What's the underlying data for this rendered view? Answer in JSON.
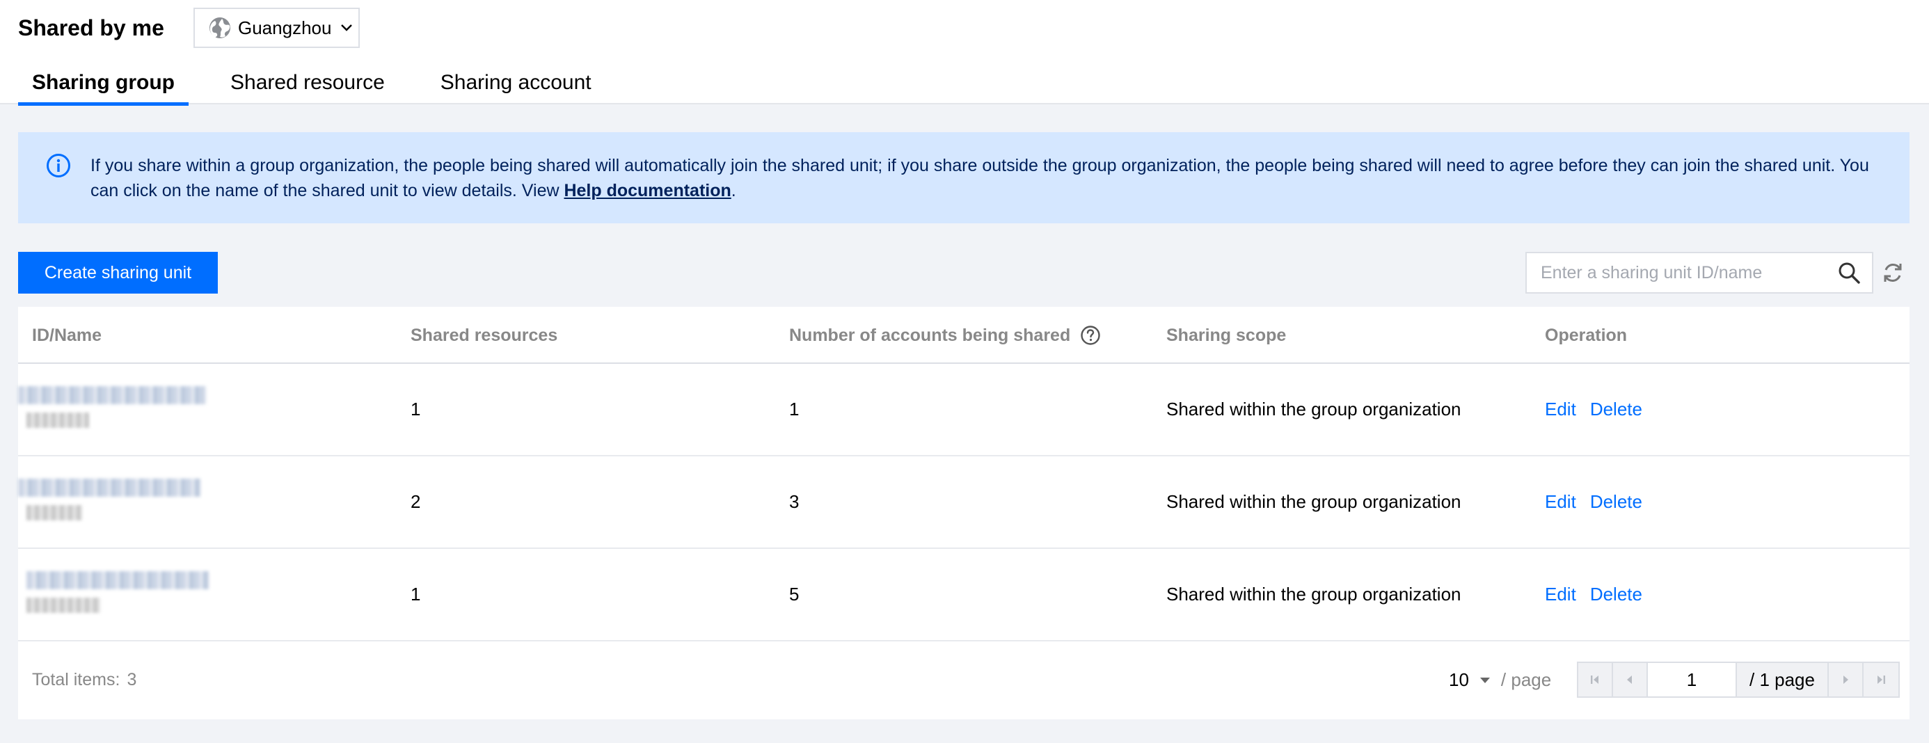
{
  "header": {
    "title": "Shared by me",
    "region": "Guangzhou"
  },
  "tabs": [
    {
      "label": "Sharing group",
      "active": true
    },
    {
      "label": "Shared resource",
      "active": false
    },
    {
      "label": "Sharing account",
      "active": false
    }
  ],
  "alert": {
    "text": "If you share within a group organization, the people being shared will automatically join the shared unit; if you share outside the group organization, the people being shared will need to agree before they can join the shared unit. You can click on the name of the shared unit to view details. View ",
    "link": "Help documentation",
    "suffix": "."
  },
  "toolbar": {
    "create_label": "Create sharing unit",
    "search_placeholder": "Enter a sharing unit ID/name"
  },
  "table": {
    "columns": [
      "ID/Name",
      "Shared resources",
      "Number of accounts being shared",
      "Sharing scope",
      "Operation"
    ],
    "rows": [
      {
        "shared_resources": "1",
        "accounts": "1",
        "scope": "Shared within the group organization",
        "edit": "Edit",
        "delete": "Delete"
      },
      {
        "shared_resources": "2",
        "accounts": "3",
        "scope": "Shared within the group organization",
        "edit": "Edit",
        "delete": "Delete"
      },
      {
        "shared_resources": "1",
        "accounts": "5",
        "scope": "Shared within the group organization",
        "edit": "Edit",
        "delete": "Delete"
      }
    ]
  },
  "pagination": {
    "total_label": "Total items:",
    "total": "3",
    "page_size": "10",
    "page_size_unit": "/ page",
    "current_page": "1",
    "total_pages": "/ 1 page"
  },
  "colors": {
    "accent": "#006eff",
    "alert_bg": "#d5e7ff",
    "alert_text": "#00215b"
  }
}
